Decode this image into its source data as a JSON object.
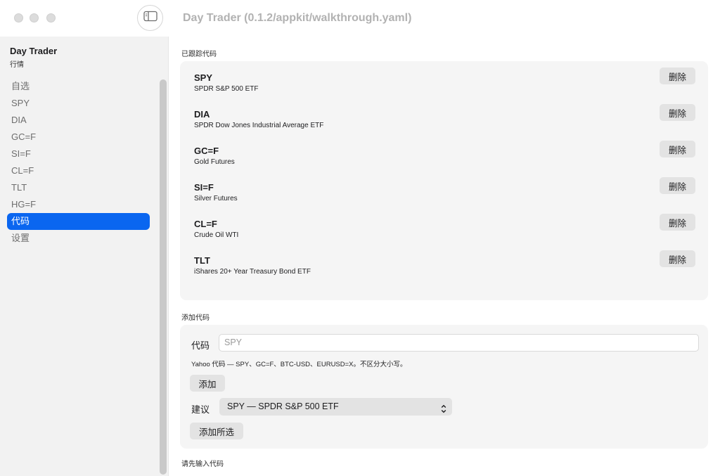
{
  "window": {
    "title": "Day Trader (0.1.2/appkit/walkthrough.yaml)"
  },
  "sidebar": {
    "app_name": "Day Trader",
    "app_subtitle": "行情",
    "items": [
      {
        "label": "自选"
      },
      {
        "label": "SPY"
      },
      {
        "label": "DIA"
      },
      {
        "label": "GC=F"
      },
      {
        "label": "SI=F"
      },
      {
        "label": "CL=F"
      },
      {
        "label": "TLT"
      },
      {
        "label": "HG=F"
      },
      {
        "label": "代码",
        "active": true
      },
      {
        "label": "设置"
      }
    ]
  },
  "tracked": {
    "section_label": "已跟踪代码",
    "delete_label": "删除",
    "symbols": [
      {
        "code": "SPY",
        "name": "SPDR S&P 500 ETF"
      },
      {
        "code": "DIA",
        "name": "SPDR Dow Jones Industrial Average ETF"
      },
      {
        "code": "GC=F",
        "name": "Gold Futures"
      },
      {
        "code": "SI=F",
        "name": "Silver Futures"
      },
      {
        "code": "CL=F",
        "name": "Crude Oil WTI"
      },
      {
        "code": "TLT",
        "name": "iShares 20+ Year Treasury Bond ETF"
      }
    ]
  },
  "add": {
    "section_label": "添加代码",
    "field_label": "代码",
    "input_value": "",
    "input_placeholder": "SPY",
    "hint": "Yahoo 代码 — SPY、GC=F、BTC-USD、EURUSD=X。不区分大小写。",
    "add_button": "添加",
    "suggest_label": "建议",
    "suggest_selected": "SPY — SPDR S&P 500 ETF",
    "add_selected_button": "添加所选"
  },
  "status": {
    "message": "请先输入代码"
  },
  "colors": {
    "accent": "#0a66f0",
    "sidebar_bg": "#f2f2f2",
    "card_bg": "#f5f5f5",
    "button_bg": "#e3e3e3"
  },
  "icons": {
    "sidebar_toggle": "sidebar-left-icon",
    "popup_arrows": "chevron-up-down-icon"
  }
}
